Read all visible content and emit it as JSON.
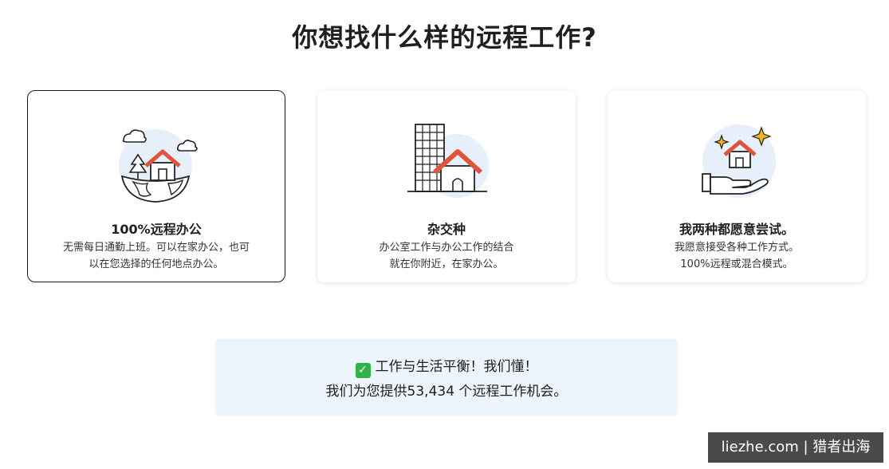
{
  "page": {
    "title": "你想找什么样的远程工作?"
  },
  "cards": [
    {
      "title": "100%远程办公",
      "desc_line1": "无需每日通勤上班。可以在家办公，也可",
      "desc_line2": "以在您选择的任何地点办公。",
      "selected": true,
      "icon": "globe-house-icon"
    },
    {
      "title": "杂交种",
      "desc_line1": "办公室工作与办公工作的结合",
      "desc_line2": "就在你附近，在家办公。",
      "selected": false,
      "icon": "office-house-icon"
    },
    {
      "title": "我两种都愿意尝试。",
      "desc_line1": "我愿意接受各种工作方式。",
      "desc_line2": "100%远程或混合模式。",
      "selected": false,
      "icon": "hand-house-icon"
    }
  ],
  "banner": {
    "check_icon": "checkmark-icon",
    "line1": "工作与生活平衡！我们懂！",
    "line2": "我们为您提供53,434 个远程工作机会。"
  },
  "watermark": "liezhe.com | 猎者出海",
  "colors": {
    "accent_red": "#e0533d",
    "circle_bg": "#e6effa",
    "check_green": "#2fb24c",
    "banner_bg": "#eef4fc"
  }
}
